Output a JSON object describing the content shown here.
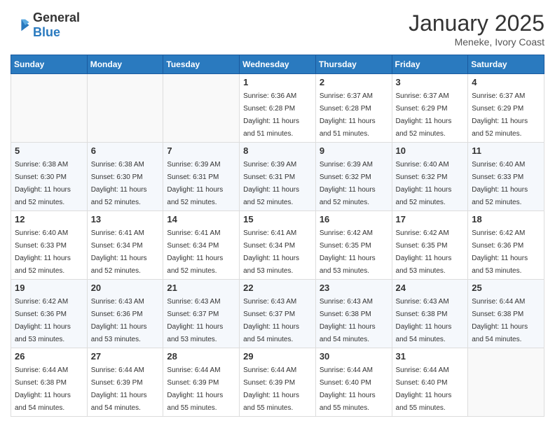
{
  "header": {
    "logo_general": "General",
    "logo_blue": "Blue",
    "month_title": "January 2025",
    "subtitle": "Meneke, Ivory Coast"
  },
  "weekdays": [
    "Sunday",
    "Monday",
    "Tuesday",
    "Wednesday",
    "Thursday",
    "Friday",
    "Saturday"
  ],
  "weeks": [
    [
      {
        "day": "",
        "sunrise": "",
        "sunset": "",
        "daylight": ""
      },
      {
        "day": "",
        "sunrise": "",
        "sunset": "",
        "daylight": ""
      },
      {
        "day": "",
        "sunrise": "",
        "sunset": "",
        "daylight": ""
      },
      {
        "day": "1",
        "sunrise": "Sunrise: 6:36 AM",
        "sunset": "Sunset: 6:28 PM",
        "daylight": "Daylight: 11 hours and 51 minutes."
      },
      {
        "day": "2",
        "sunrise": "Sunrise: 6:37 AM",
        "sunset": "Sunset: 6:28 PM",
        "daylight": "Daylight: 11 hours and 51 minutes."
      },
      {
        "day": "3",
        "sunrise": "Sunrise: 6:37 AM",
        "sunset": "Sunset: 6:29 PM",
        "daylight": "Daylight: 11 hours and 52 minutes."
      },
      {
        "day": "4",
        "sunrise": "Sunrise: 6:37 AM",
        "sunset": "Sunset: 6:29 PM",
        "daylight": "Daylight: 11 hours and 52 minutes."
      }
    ],
    [
      {
        "day": "5",
        "sunrise": "Sunrise: 6:38 AM",
        "sunset": "Sunset: 6:30 PM",
        "daylight": "Daylight: 11 hours and 52 minutes."
      },
      {
        "day": "6",
        "sunrise": "Sunrise: 6:38 AM",
        "sunset": "Sunset: 6:30 PM",
        "daylight": "Daylight: 11 hours and 52 minutes."
      },
      {
        "day": "7",
        "sunrise": "Sunrise: 6:39 AM",
        "sunset": "Sunset: 6:31 PM",
        "daylight": "Daylight: 11 hours and 52 minutes."
      },
      {
        "day": "8",
        "sunrise": "Sunrise: 6:39 AM",
        "sunset": "Sunset: 6:31 PM",
        "daylight": "Daylight: 11 hours and 52 minutes."
      },
      {
        "day": "9",
        "sunrise": "Sunrise: 6:39 AM",
        "sunset": "Sunset: 6:32 PM",
        "daylight": "Daylight: 11 hours and 52 minutes."
      },
      {
        "day": "10",
        "sunrise": "Sunrise: 6:40 AM",
        "sunset": "Sunset: 6:32 PM",
        "daylight": "Daylight: 11 hours and 52 minutes."
      },
      {
        "day": "11",
        "sunrise": "Sunrise: 6:40 AM",
        "sunset": "Sunset: 6:33 PM",
        "daylight": "Daylight: 11 hours and 52 minutes."
      }
    ],
    [
      {
        "day": "12",
        "sunrise": "Sunrise: 6:40 AM",
        "sunset": "Sunset: 6:33 PM",
        "daylight": "Daylight: 11 hours and 52 minutes."
      },
      {
        "day": "13",
        "sunrise": "Sunrise: 6:41 AM",
        "sunset": "Sunset: 6:34 PM",
        "daylight": "Daylight: 11 hours and 52 minutes."
      },
      {
        "day": "14",
        "sunrise": "Sunrise: 6:41 AM",
        "sunset": "Sunset: 6:34 PM",
        "daylight": "Daylight: 11 hours and 52 minutes."
      },
      {
        "day": "15",
        "sunrise": "Sunrise: 6:41 AM",
        "sunset": "Sunset: 6:34 PM",
        "daylight": "Daylight: 11 hours and 53 minutes."
      },
      {
        "day": "16",
        "sunrise": "Sunrise: 6:42 AM",
        "sunset": "Sunset: 6:35 PM",
        "daylight": "Daylight: 11 hours and 53 minutes."
      },
      {
        "day": "17",
        "sunrise": "Sunrise: 6:42 AM",
        "sunset": "Sunset: 6:35 PM",
        "daylight": "Daylight: 11 hours and 53 minutes."
      },
      {
        "day": "18",
        "sunrise": "Sunrise: 6:42 AM",
        "sunset": "Sunset: 6:36 PM",
        "daylight": "Daylight: 11 hours and 53 minutes."
      }
    ],
    [
      {
        "day": "19",
        "sunrise": "Sunrise: 6:42 AM",
        "sunset": "Sunset: 6:36 PM",
        "daylight": "Daylight: 11 hours and 53 minutes."
      },
      {
        "day": "20",
        "sunrise": "Sunrise: 6:43 AM",
        "sunset": "Sunset: 6:36 PM",
        "daylight": "Daylight: 11 hours and 53 minutes."
      },
      {
        "day": "21",
        "sunrise": "Sunrise: 6:43 AM",
        "sunset": "Sunset: 6:37 PM",
        "daylight": "Daylight: 11 hours and 53 minutes."
      },
      {
        "day": "22",
        "sunrise": "Sunrise: 6:43 AM",
        "sunset": "Sunset: 6:37 PM",
        "daylight": "Daylight: 11 hours and 54 minutes."
      },
      {
        "day": "23",
        "sunrise": "Sunrise: 6:43 AM",
        "sunset": "Sunset: 6:38 PM",
        "daylight": "Daylight: 11 hours and 54 minutes."
      },
      {
        "day": "24",
        "sunrise": "Sunrise: 6:43 AM",
        "sunset": "Sunset: 6:38 PM",
        "daylight": "Daylight: 11 hours and 54 minutes."
      },
      {
        "day": "25",
        "sunrise": "Sunrise: 6:44 AM",
        "sunset": "Sunset: 6:38 PM",
        "daylight": "Daylight: 11 hours and 54 minutes."
      }
    ],
    [
      {
        "day": "26",
        "sunrise": "Sunrise: 6:44 AM",
        "sunset": "Sunset: 6:38 PM",
        "daylight": "Daylight: 11 hours and 54 minutes."
      },
      {
        "day": "27",
        "sunrise": "Sunrise: 6:44 AM",
        "sunset": "Sunset: 6:39 PM",
        "daylight": "Daylight: 11 hours and 54 minutes."
      },
      {
        "day": "28",
        "sunrise": "Sunrise: 6:44 AM",
        "sunset": "Sunset: 6:39 PM",
        "daylight": "Daylight: 11 hours and 55 minutes."
      },
      {
        "day": "29",
        "sunrise": "Sunrise: 6:44 AM",
        "sunset": "Sunset: 6:39 PM",
        "daylight": "Daylight: 11 hours and 55 minutes."
      },
      {
        "day": "30",
        "sunrise": "Sunrise: 6:44 AM",
        "sunset": "Sunset: 6:40 PM",
        "daylight": "Daylight: 11 hours and 55 minutes."
      },
      {
        "day": "31",
        "sunrise": "Sunrise: 6:44 AM",
        "sunset": "Sunset: 6:40 PM",
        "daylight": "Daylight: 11 hours and 55 minutes."
      },
      {
        "day": "",
        "sunrise": "",
        "sunset": "",
        "daylight": ""
      }
    ]
  ]
}
